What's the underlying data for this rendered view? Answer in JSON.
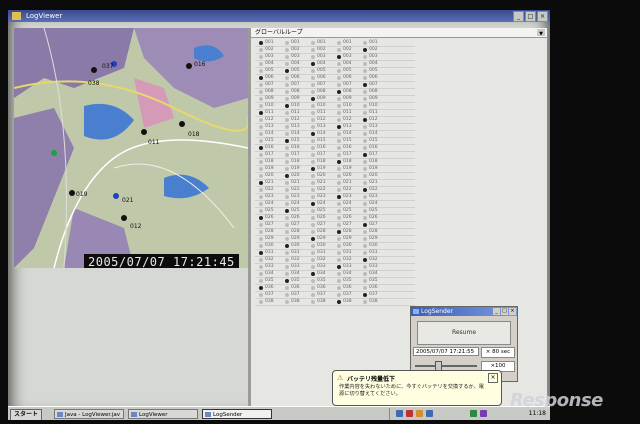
{
  "window": {
    "title": "LogViewer"
  },
  "map": {
    "timestamp": "2005/07/07  17:21:45",
    "labels": [
      "036",
      "037",
      "038",
      "016",
      "011",
      "018",
      "019",
      "021",
      "012"
    ]
  },
  "panel": {
    "header": "グローバルループ"
  },
  "list": {
    "ids": [
      "001",
      "002",
      "003",
      "004",
      "005",
      "006",
      "007",
      "008",
      "009",
      "010",
      "011",
      "012",
      "013",
      "014",
      "015",
      "016",
      "017",
      "018",
      "019",
      "020",
      "021",
      "022",
      "023",
      "024",
      "025",
      "026",
      "027",
      "028",
      "029",
      "030",
      "031",
      "032",
      "033",
      "034",
      "035",
      "036",
      "037",
      "038"
    ],
    "highlight_labels": [
      "016",
      "011",
      "014",
      "013",
      "032"
    ]
  },
  "dialog": {
    "title": "LogSender",
    "resume_label": "Resume",
    "time_value": "2005/07/07 17:21:55",
    "seconds_value": "× 80 sec",
    "zoom_value": "×100"
  },
  "balloon": {
    "title": "バッテリ残量低下",
    "body": "作業内容を失わないために、今すぐバッテリを交換するか、電源に切り替えてください。"
  },
  "taskbar": {
    "start": "スタート",
    "tasks": [
      "Java - LogViewer.jav",
      "LogViewer",
      "LogSender"
    ],
    "clock": "11:18"
  },
  "watermark": "Response",
  "colors": {
    "title_bar": "#3a4a90",
    "map_bg": "#bfc9a9",
    "water": "#4a7fd0",
    "urban": "#8a7aa8"
  }
}
